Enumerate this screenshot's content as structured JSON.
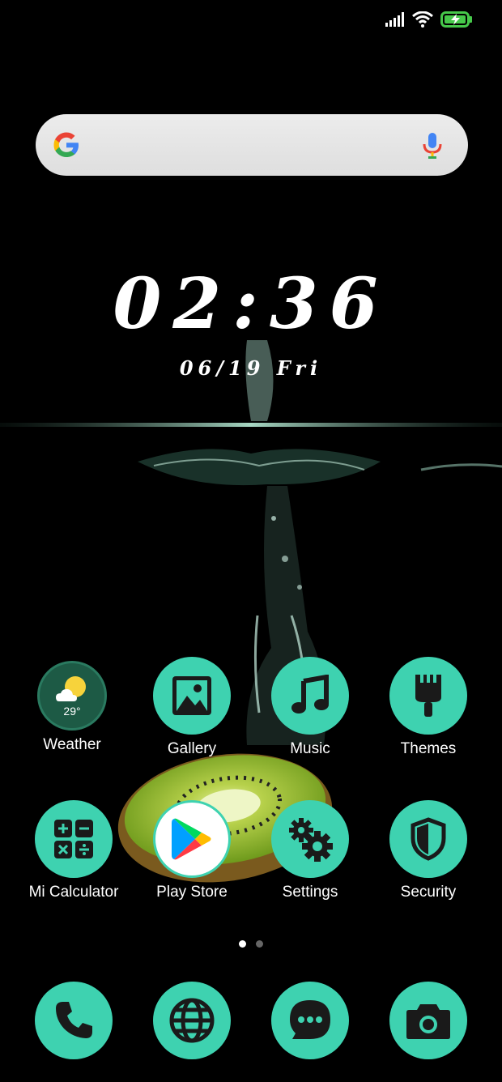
{
  "status_bar": {
    "icons": [
      "signal-icon",
      "wifi-icon",
      "battery-charging-icon"
    ],
    "battery_color": "#46c84a"
  },
  "search": {
    "logo": "google-logo-icon",
    "mic": "mic-icon"
  },
  "clock": {
    "time": "02:36",
    "date": "06/19  Fri"
  },
  "apps": [
    {
      "label": "Weather",
      "icon": "weather-icon",
      "temperature": "29°"
    },
    {
      "label": "Gallery",
      "icon": "gallery-icon"
    },
    {
      "label": "Music",
      "icon": "music-note-icon"
    },
    {
      "label": "Themes",
      "icon": "paint-brush-icon"
    },
    {
      "label": "Mi Calculator",
      "icon": "calculator-icon"
    },
    {
      "label": "Play Store",
      "icon": "play-store-icon"
    },
    {
      "label": "Settings",
      "icon": "gears-icon"
    },
    {
      "label": "Security",
      "icon": "shield-icon"
    }
  ],
  "page_indicator": {
    "pages": 2,
    "current": 1
  },
  "dock": [
    {
      "icon": "phone-icon"
    },
    {
      "icon": "browser-globe-icon"
    },
    {
      "icon": "messages-icon"
    },
    {
      "icon": "camera-icon"
    }
  ],
  "colors": {
    "icon_accent": "#3ed2b0",
    "icon_glyph": "#1a1a1a",
    "background": "#000000"
  }
}
